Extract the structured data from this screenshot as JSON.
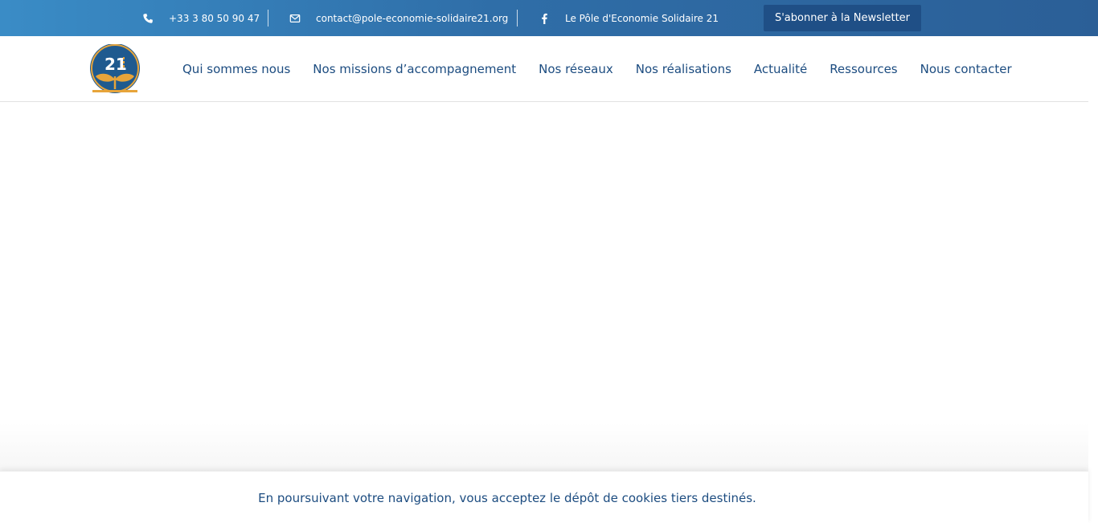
{
  "topbar": {
    "phone": {
      "icon": "phone-icon",
      "text": "+33 3 80 50 90 47"
    },
    "email": {
      "icon": "envelope-icon",
      "text": "contact@pole-economie-solidaire21.org"
    },
    "facebook": {
      "icon": "facebook-icon",
      "text": "Le Pôle d'Economie Solidaire 21"
    },
    "newsletter_label": "S'abonner à la Newsletter",
    "colors": {
      "gradient_start": "#3a8cc6",
      "gradient_end": "#2b5f97",
      "button": "#1f4f86"
    }
  },
  "header": {
    "logo": {
      "icon": "pes21-logo",
      "text": "21"
    },
    "nav": [
      {
        "label": "Qui sommes nous"
      },
      {
        "label": "Nos missions d’accompagnement"
      },
      {
        "label": "Nos réseaux"
      },
      {
        "label": "Nos réalisations"
      },
      {
        "label": "Actualité"
      },
      {
        "label": "Ressources"
      },
      {
        "label": "Nous contacter"
      }
    ],
    "nav_color": "#1c4c80"
  },
  "cookie_banner": {
    "text": "En poursuivant votre navigation, vous acceptez le dépôt de cookies tiers destinés."
  }
}
